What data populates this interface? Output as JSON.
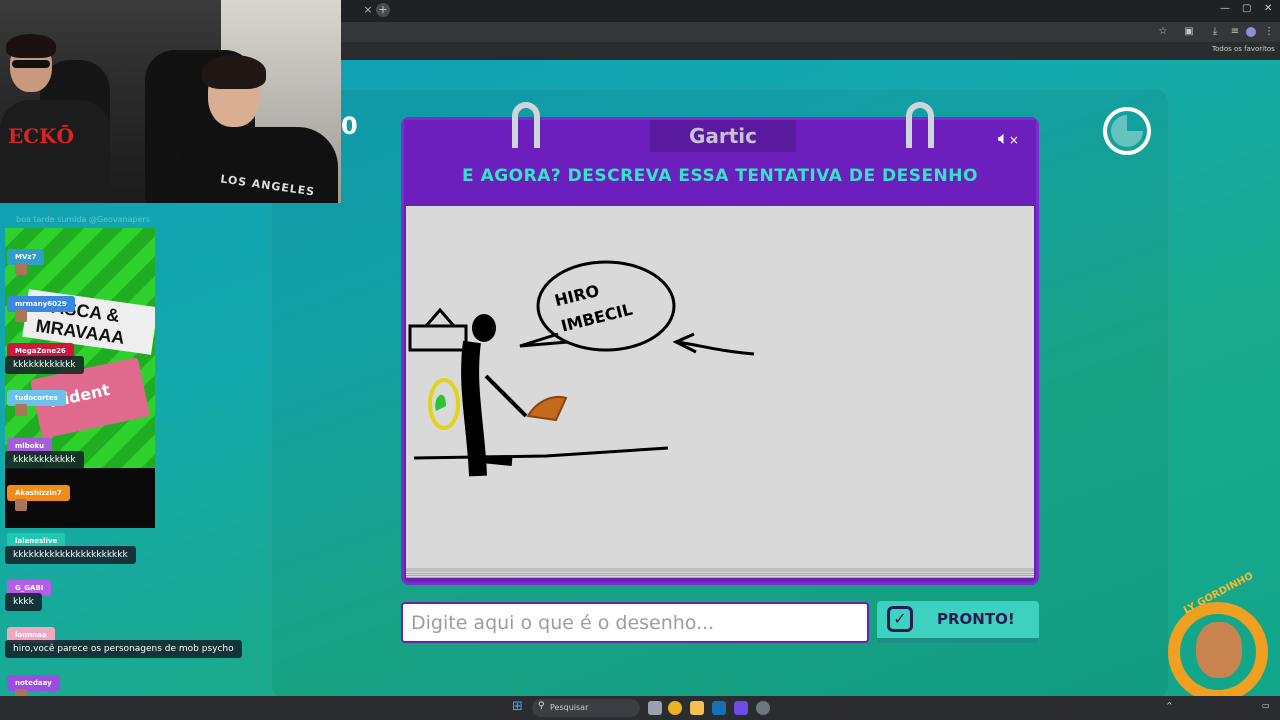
{
  "browser": {
    "tab_close": "×",
    "tab_new": "+",
    "bookmarks_label": "Todos os favoritos"
  },
  "chat": {
    "header_text": "boa tarde sumida @Geovanapers",
    "stream_title": "CASCA & MRAVAAA",
    "stream_pack": "Trident",
    "messages": [
      {
        "user": "MVz7",
        "color": "#2f9ec8",
        "text": ""
      },
      {
        "user": "mrmany6029",
        "color": "#3a86e0",
        "text": ""
      },
      {
        "user": "MegaZone26",
        "color": "#d3163c",
        "text": "kkkkkkkkkkkk"
      },
      {
        "user": "tudocortes",
        "color": "#6cc1ea",
        "text": ""
      },
      {
        "user": "mlboku",
        "color": "#a35ed8",
        "text": "kkkkkkkkkkkk"
      },
      {
        "user": "Akashizzin7",
        "color": "#f08c1a",
        "text": ""
      },
      {
        "user": "lalaneslive",
        "color": "#20c7b0",
        "text": "kkkkkkkkkkkkkkkkkkkkkk"
      },
      {
        "user": "G_GABI",
        "color": "#b45ee8",
        "text": "kkkk"
      },
      {
        "user": "lonnnaa",
        "color": "#f2a7c0",
        "text": "hiro,você parece os personagens de mob psycho"
      },
      {
        "user": "notedaay",
        "color": "#9d4be0",
        "text": ""
      }
    ]
  },
  "game": {
    "logo": "Gartic",
    "prompt": "E AGORA? DESCREVA ESSA TENTATIVA DE DESENHO",
    "score_left": "0",
    "drawing_text_line1": "HIRO",
    "drawing_text_line2": "IMBECIL",
    "answer_placeholder": "Digite aqui o que é o desenho...",
    "ready_label": "PRONTO!",
    "sound_icon": "speaker-muted-icon"
  },
  "emblem": {
    "text": "LY GORDINHO"
  },
  "taskbar": {
    "search_placeholder": "Pesquisar"
  }
}
